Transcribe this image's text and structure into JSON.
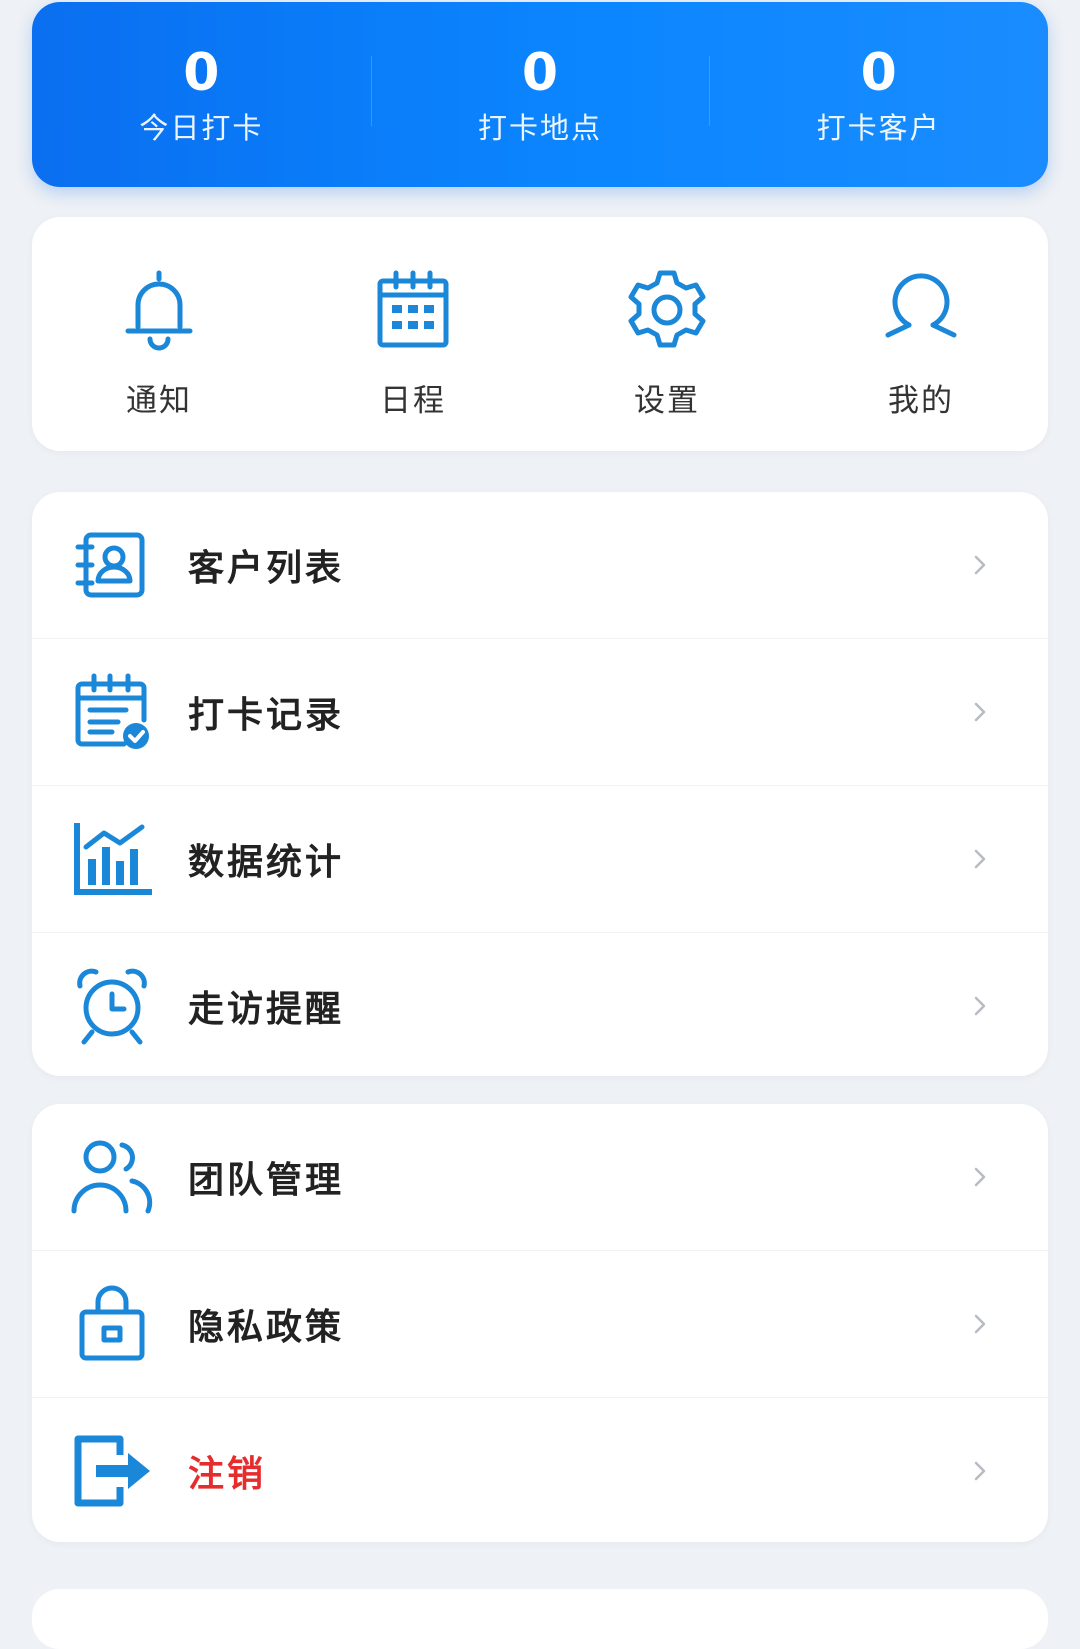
{
  "stats": [
    {
      "value": "0",
      "label": "今日打卡"
    },
    {
      "value": "0",
      "label": "打卡地点"
    },
    {
      "value": "0",
      "label": "打卡客户"
    }
  ],
  "quick_actions": [
    {
      "icon": "bell-icon",
      "label": "通知"
    },
    {
      "icon": "calendar-icon",
      "label": "日程"
    },
    {
      "icon": "gear-icon",
      "label": "设置"
    },
    {
      "icon": "user-icon",
      "label": "我的"
    }
  ],
  "menu_group_1": [
    {
      "icon": "contact-book-icon",
      "label": "客户列表"
    },
    {
      "icon": "calendar-check-icon",
      "label": "打卡记录"
    },
    {
      "icon": "bar-chart-icon",
      "label": "数据统计"
    },
    {
      "icon": "alarm-clock-icon",
      "label": "走访提醒"
    }
  ],
  "menu_group_2": [
    {
      "icon": "team-icon",
      "label": "团队管理"
    },
    {
      "icon": "lock-icon",
      "label": "隐私政策"
    },
    {
      "icon": "logout-icon",
      "label": "注销"
    }
  ],
  "colors": {
    "accent": "#0b86ff",
    "icon": "#1a87d8",
    "danger": "#e52d2d"
  }
}
